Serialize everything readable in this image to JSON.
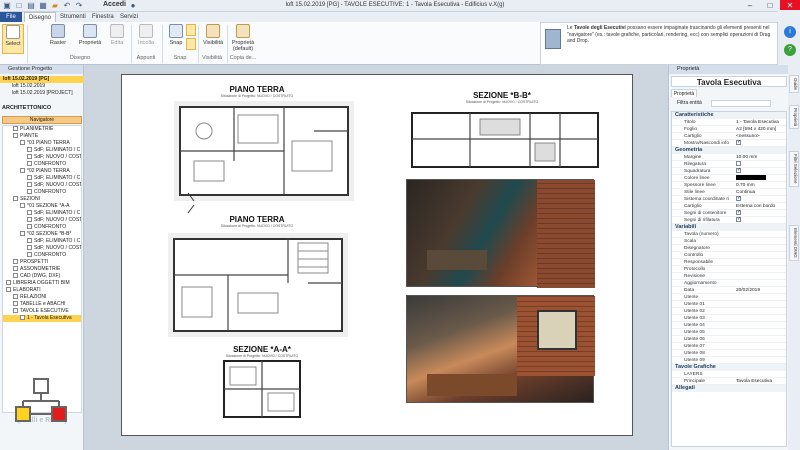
{
  "app": {
    "title": "loft 15.02.2019 [PG]  -  TAVOLE ESECUTIVE: 1 - Tavola Esecutiva  -  Edificius v.X(g)",
    "user": "Accedi"
  },
  "ribbon": {
    "tabs": [
      "File",
      "Disegno",
      "Strumenti",
      "Finestra",
      "Servizi"
    ],
    "active_tab": "Disegno",
    "buttons": {
      "select": "Select",
      "raster": "Raster",
      "properties": "Proprietà",
      "edit": "Edita",
      "paste": "Incolla",
      "snap": "Snap",
      "visibility": "Visibilità",
      "default_props": "Proprietà (default)"
    },
    "groups": {
      "disegno": "Disegno",
      "appunti": "Appunti",
      "snap": "Snap",
      "visibilita": "Visibilità",
      "copia": "Copia de..."
    }
  },
  "help": {
    "bold": "Tavole degli Esecutivi",
    "pre": "Le ",
    "text": " possano essere impaginate trascinando gli elementi presenti nel \"navigatore\" (es.: tavole grafiche, particolari, rendering, ecc) con semplici operazioni di Drag and Drop."
  },
  "left_panel": {
    "title": "Gestione Progetto",
    "projects": [
      "loft 15.02.2019 [PG]",
      "loft 15.02.2019",
      "loft 15.02.2019 [PROJECT]"
    ],
    "section": "ARCHITETTONICO",
    "navigator": "Navigatore",
    "tree": [
      {
        "label": "PLANIMETRIE",
        "indent": 1
      },
      {
        "label": "PIANTE",
        "indent": 1
      },
      {
        "label": "*01 PIANO TERRA",
        "indent": 2
      },
      {
        "label": "SdF; ELIMINATO / C",
        "indent": 3
      },
      {
        "label": "SdF; NUOVO / COST",
        "indent": 3
      },
      {
        "label": "CONFRONTO",
        "indent": 3
      },
      {
        "label": "*02 PIANO TERRA",
        "indent": 2
      },
      {
        "label": "SdF; ELIMINATO / C",
        "indent": 3
      },
      {
        "label": "SdF; NUOVO / COST",
        "indent": 3
      },
      {
        "label": "CONFRONTO",
        "indent": 3
      },
      {
        "label": "SEZIONI",
        "indent": 1
      },
      {
        "label": "*01 SEZIONE  *A-A",
        "indent": 2
      },
      {
        "label": "SdF; ELIMINATO / C",
        "indent": 3
      },
      {
        "label": "SdF; NUOVO / COST",
        "indent": 3
      },
      {
        "label": "CONFRONTO",
        "indent": 3
      },
      {
        "label": "*02 SEZIONE  *B-B*",
        "indent": 2
      },
      {
        "label": "SdF; ELIMINATO / C",
        "indent": 3
      },
      {
        "label": "SdF; NUOVO / COST",
        "indent": 3
      },
      {
        "label": "CONFRONTO",
        "indent": 3
      },
      {
        "label": "PROSPETTI",
        "indent": 1
      },
      {
        "label": "ASSONOMETRIE",
        "indent": 1
      },
      {
        "label": "CAD (DWG, DXF)",
        "indent": 1
      },
      {
        "label": "LIBRERIA OGGETTI BIM",
        "indent": 0
      },
      {
        "label": "ELABORATI",
        "indent": 0
      },
      {
        "label": "RELAZIONI",
        "indent": 1
      },
      {
        "label": "TABELLE e ABACHI",
        "indent": 1
      },
      {
        "label": "TAVOLE ESECUTIVE",
        "indent": 1
      },
      {
        "label": "1 - Tavola Esecutiva",
        "indent": 2,
        "selected": true
      }
    ],
    "legend": "[Gialli e Rossi]"
  },
  "sheet": {
    "views": {
      "pt1": {
        "title": "PIANO TERRA",
        "sub": "Situazione di Progetto: NUOVO / COSTRUITO"
      },
      "pt2": {
        "title": "PIANO TERRA",
        "sub": "Situazione di Progetto: NUOVO / COSTRUITO"
      },
      "sa": {
        "title": "SEZIONE  *A-A*",
        "sub": "Situazione di Progetto: NUOVO / COSTRUITO"
      },
      "sb": {
        "title": "SEZIONE  *B-B*",
        "sub": "Situazione di Progetto: NUOVO / COSTRUITO"
      }
    }
  },
  "right_panel": {
    "title": "Proprietà",
    "heading": "Tavola Esecutiva",
    "tab": "Proprietà",
    "filter_label": "Filtra entità",
    "sections": [
      {
        "name": "Caratteristiche",
        "rows": [
          {
            "k": "Titolo",
            "v": "1 - Tavola Esecutiva"
          },
          {
            "k": "Foglio",
            "v": "A2 [594 x 420 mm]"
          },
          {
            "k": "Cartiglio",
            "v": "<nessuno>"
          },
          {
            "k": "Mostra/Nascondi info",
            "v": "",
            "check": true
          }
        ]
      },
      {
        "name": "Geometria",
        "rows": [
          {
            "k": "Margine",
            "v": "10.00 mm"
          },
          {
            "k": "Rilegatura",
            "v": "",
            "check": false
          },
          {
            "k": "Squadratura",
            "v": "",
            "check": true
          },
          {
            "k": "Colore linee",
            "v": "",
            "color": "#000000"
          },
          {
            "k": "Spessore linee",
            "v": "0.70 mm"
          },
          {
            "k": "Stile linee",
            "v": "Continua"
          },
          {
            "k": "Sistema coordinate ri",
            "v": "",
            "check": true
          },
          {
            "k": "Cartiglio",
            "v": "Esterna con bordo"
          },
          {
            "k": "Segni di contenitore",
            "v": "",
            "check": true
          },
          {
            "k": "Segni di rifilatura",
            "v": "",
            "check": true
          }
        ]
      },
      {
        "name": "Variabili",
        "rows": [
          {
            "k": "Tavola (numero)",
            "v": ""
          },
          {
            "k": "Scala",
            "v": ""
          },
          {
            "k": "Disegnatore",
            "v": ""
          },
          {
            "k": "Controllo",
            "v": ""
          },
          {
            "k": "Responsabile",
            "v": ""
          },
          {
            "k": "Protocollo",
            "v": ""
          },
          {
            "k": "Revisione",
            "v": ""
          },
          {
            "k": "Aggiornamento",
            "v": ""
          },
          {
            "k": "Data",
            "v": "20/02/2019"
          },
          {
            "k": "Utente",
            "v": ""
          },
          {
            "k": "Utente 01",
            "v": ""
          },
          {
            "k": "Utente 02",
            "v": ""
          },
          {
            "k": "Utente 03",
            "v": ""
          },
          {
            "k": "Utente 04",
            "v": ""
          },
          {
            "k": "Utente 05",
            "v": ""
          },
          {
            "k": "Utente 06",
            "v": ""
          },
          {
            "k": "Utente 07",
            "v": ""
          },
          {
            "k": "Utente 08",
            "v": ""
          },
          {
            "k": "Utente 09",
            "v": ""
          }
        ]
      },
      {
        "name": "Tavole Grafiche",
        "rows": [
          {
            "k": "LAYERS",
            "v": ""
          },
          {
            "k": "Principale",
            "v": "Tavola Esecutiva"
          }
        ]
      },
      {
        "name": "Allegati",
        "rows": []
      }
    ]
  },
  "vertical_tabs": [
    "Guide",
    "Proprietà",
    "Filtri Selezione",
    "Elementi DWG"
  ],
  "colors": {
    "accent": "#2b579a",
    "selection": "#ffd34f",
    "navigator": "#f6c987"
  }
}
